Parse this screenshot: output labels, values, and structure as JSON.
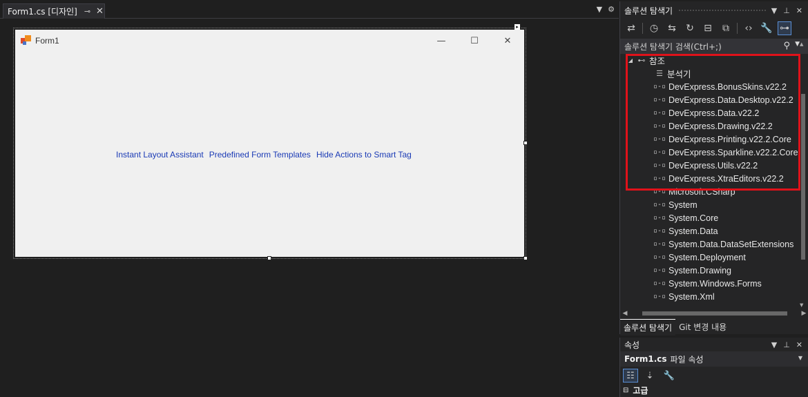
{
  "document_tab": {
    "title": "Form1.cs [디자인]",
    "pin_icon": "pin-icon",
    "close_icon": "close-icon"
  },
  "form": {
    "title": "Form1",
    "minimize": "—",
    "maximize": "☐",
    "close": "✕",
    "smart_links": [
      "Instant Layout Assistant",
      "Predefined Form Templates",
      "Hide Actions to Smart Tag"
    ]
  },
  "solution_explorer": {
    "title": "솔루션 탐색기",
    "search_placeholder": "솔루션 탐색기 검색(Ctrl+;)",
    "tree": [
      {
        "label": "참조",
        "level": 0,
        "expander": "◢",
        "icon": "references-icon"
      },
      {
        "label": "분석기",
        "level": 1,
        "icon": "analyzer-icon"
      },
      {
        "label": "DevExpress.BonusSkins.v22.2",
        "level": 1,
        "icon": "reference-icon"
      },
      {
        "label": "DevExpress.Data.Desktop.v22.2",
        "level": 1,
        "icon": "reference-icon"
      },
      {
        "label": "DevExpress.Data.v22.2",
        "level": 1,
        "icon": "reference-icon"
      },
      {
        "label": "DevExpress.Drawing.v22.2",
        "level": 1,
        "icon": "reference-icon"
      },
      {
        "label": "DevExpress.Printing.v22.2.Core",
        "level": 1,
        "icon": "reference-icon"
      },
      {
        "label": "DevExpress.Sparkline.v22.2.Core",
        "level": 1,
        "icon": "reference-icon"
      },
      {
        "label": "DevExpress.Utils.v22.2",
        "level": 1,
        "icon": "reference-icon"
      },
      {
        "label": "DevExpress.XtraEditors.v22.2",
        "level": 1,
        "icon": "reference-icon"
      },
      {
        "label": "Microsoft.CSharp",
        "level": 1,
        "icon": "reference-icon"
      },
      {
        "label": "System",
        "level": 1,
        "icon": "reference-icon"
      },
      {
        "label": "System.Core",
        "level": 1,
        "icon": "reference-icon"
      },
      {
        "label": "System.Data",
        "level": 1,
        "icon": "reference-icon"
      },
      {
        "label": "System.Data.DataSetExtensions",
        "level": 1,
        "icon": "reference-icon"
      },
      {
        "label": "System.Deployment",
        "level": 1,
        "icon": "reference-icon"
      },
      {
        "label": "System.Drawing",
        "level": 1,
        "icon": "reference-icon"
      },
      {
        "label": "System.Windows.Forms",
        "level": 1,
        "icon": "reference-icon"
      },
      {
        "label": "System.Xml",
        "level": 1,
        "icon": "reference-icon"
      }
    ],
    "bottom_tabs": [
      "솔루션 탐색기",
      "Git 변경 내용"
    ]
  },
  "properties": {
    "title": "속성",
    "object_name": "Form1.cs",
    "object_type": "파일 속성",
    "category": "고급"
  },
  "colors": {
    "highlight": "#e0121a",
    "link": "#1a3ab5",
    "accent": "#5a8fd6"
  }
}
